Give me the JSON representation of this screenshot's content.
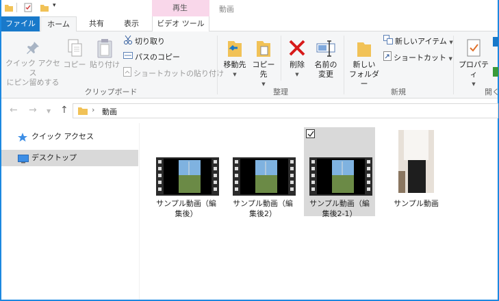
{
  "title_bar": {
    "context_tab_group": "再生",
    "window_title": "動画"
  },
  "tabs": {
    "file": "ファイル",
    "home": "ホーム",
    "share": "共有",
    "view": "表示",
    "video_tools": "ビデオ ツール"
  },
  "ribbon": {
    "clipboard": {
      "group_label": "クリップボード",
      "pin_quick_access_line1": "クイック アクセス",
      "pin_quick_access_line2": "にピン留めする",
      "copy": "コピー",
      "paste": "貼り付け",
      "cut": "切り取り",
      "copy_path": "パスのコピー",
      "paste_shortcut": "ショートカットの貼り付け"
    },
    "organize": {
      "group_label": "整理",
      "move_to": "移動先",
      "copy_to": "コピー先",
      "delete": "削除",
      "rename_line1": "名前の",
      "rename_line2": "変更"
    },
    "new": {
      "group_label": "新規",
      "new_folder_line1": "新しい",
      "new_folder_line2": "フォルダー",
      "new_item": "新しいアイテム",
      "shortcut": "ショートカット"
    },
    "open": {
      "group_label": "開く",
      "properties": "プロパティ"
    }
  },
  "address_bar": {
    "path_segment": "動画"
  },
  "nav_pane": {
    "items": [
      {
        "label": "クイック アクセス",
        "icon": "star-icon",
        "selected": false
      },
      {
        "label": "デスクトップ",
        "icon": "desktop-icon",
        "selected": true
      }
    ]
  },
  "files": [
    {
      "name": "サンプル動画（編集後）",
      "line1": "サンプル動画（編",
      "line2": "集後）",
      "type": "video",
      "selected": false
    },
    {
      "name": "サンプル動画（編集後2）",
      "line1": "サンプル動画（編",
      "line2": "集後2）",
      "type": "video",
      "selected": false
    },
    {
      "name": "サンプル動画（編集後2-1）",
      "line1": "サンプル動画（編",
      "line2": "集後2-1）",
      "type": "video",
      "selected": true,
      "checked": true
    },
    {
      "name": "サンプル動画",
      "line1": "サンプル動画",
      "line2": "",
      "type": "video-portrait",
      "selected": false
    }
  ],
  "colors": {
    "accent": "#1979ca",
    "window_border": "#1c88e0",
    "context_tab": "#f9d7ea",
    "selection": "#d9d9d9",
    "delete_red": "#d71a1a"
  }
}
